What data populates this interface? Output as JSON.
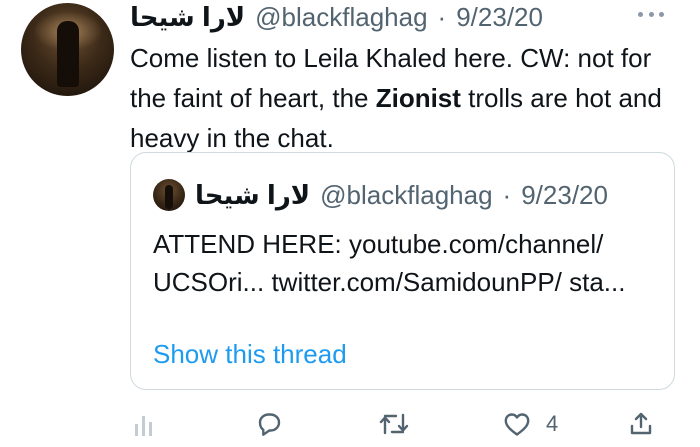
{
  "tweet": {
    "display_name": "لارا شيحا",
    "handle": "@blackflaghag",
    "separator": "·",
    "date": "9/23/20",
    "text_part1": "Come listen to Leila Khaled here. CW: not for the faint of heart, the ",
    "text_bold": "Zionist",
    "text_part2": " trolls are hot and heavy in the chat."
  },
  "quote": {
    "display_name": "لارا شيحا",
    "handle": "@blackflaghag",
    "separator": "·",
    "date": "9/23/20",
    "text": "ATTEND HERE: youtube.com/channel/ UCSOri... twitter.com/SamidounPP/ sta...",
    "show_thread_label": "Show this thread"
  },
  "actions": {
    "like_count": "4"
  },
  "icons": {
    "more": "more-icon",
    "analytics": "analytics-icon",
    "reply": "reply-icon",
    "retweet": "retweet-icon",
    "like": "heart-icon",
    "share": "share-icon"
  },
  "colors": {
    "text": "#0f1419",
    "secondary": "#536471",
    "link": "#1d9bf0",
    "border": "#cfd9de"
  }
}
